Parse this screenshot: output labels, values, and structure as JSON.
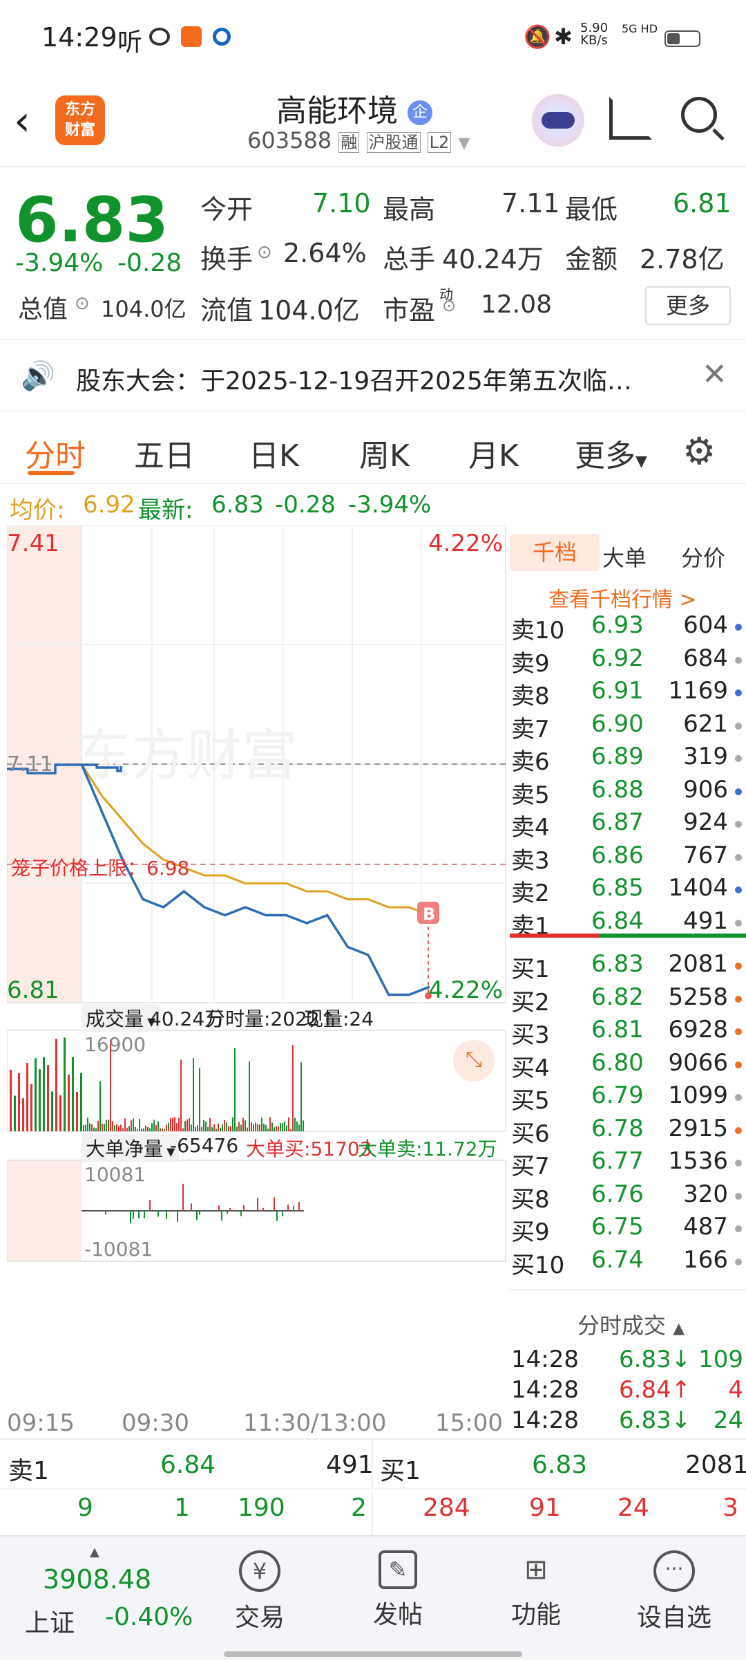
{
  "status_bar": {
    "time": "14:29",
    "listen": "听",
    "net_speed": "5.90",
    "net_unit": "KB/s",
    "net_type": "5G HD"
  },
  "nav": {
    "title": "高能环境",
    "title_badge": "企",
    "code": "603588",
    "tags": [
      "融",
      "沪股通",
      "L2"
    ],
    "logo_lines": [
      "东方",
      "财富"
    ]
  },
  "quote": {
    "price": "6.83",
    "change_pct": "-3.94%",
    "change": "-0.28",
    "open_label": "今开",
    "open": "7.10",
    "high_label": "最高",
    "high": "7.11",
    "low_label": "最低",
    "low": "6.81",
    "turnover_label": "换手",
    "turnover": "2.64%",
    "volume_label": "总手",
    "volume": "40.24万",
    "amount_label": "金额",
    "amount": "2.78亿",
    "total_mv_label": "总值",
    "total_mv": "104.0亿",
    "float_mv_label": "流值",
    "float_mv": "104.0亿",
    "pe_label": "市盈",
    "pe_sup": "动",
    "pe": "12.08",
    "more": "更多"
  },
  "notice": {
    "text": "股东大会：于2025-12-19召开2025年第五次临…"
  },
  "tabs": [
    "分时",
    "五日",
    "日K",
    "周K",
    "月K",
    "更多"
  ],
  "info_line": {
    "avg_label": "均价:",
    "avg": "6.92",
    "latest_label": "最新:",
    "latest": "6.83",
    "chg": "-0.28",
    "pct": "-3.94%"
  },
  "chart": {
    "price_top": "7.41",
    "pct_top": "4.22%",
    "price_bottom": "6.81",
    "pct_bottom": "4.22%",
    "ref_label": "7.11",
    "cage_label": "笼子价格上限：6.98",
    "watermark": "东方财富",
    "b_marker": "B",
    "vol_selector": "成交量",
    "vol_total": "40.24万",
    "vol_time": "分时量:2022↑",
    "vol_now": "现量:24",
    "vol_max": "16900",
    "flow_selector": "大单净量",
    "flow_net": "-65476",
    "flow_buy": "大单买:51703",
    "flow_sell": "大单卖:11.72万",
    "flow_max": "10081",
    "flow_min": "-10081",
    "time_labels": [
      "09:15",
      "09:30",
      "11:30/13:00",
      "15:00"
    ]
  },
  "chart_data": {
    "type": "line",
    "x": [
      "09:30",
      "09:40",
      "09:50",
      "10:00",
      "10:10",
      "10:20",
      "10:30",
      "10:45",
      "11:00",
      "11:15",
      "11:30",
      "13:15",
      "13:30",
      "13:45",
      "14:00",
      "14:10",
      "14:20",
      "14:28"
    ],
    "series": [
      {
        "values": [
          7.11,
          7.05,
          6.99,
          6.94,
          6.93,
          6.95,
          6.93,
          6.92,
          6.93,
          6.92,
          6.92,
          6.91,
          6.92,
          6.88,
          6.87,
          6.82,
          6.82,
          6.83
        ]
      },
      {
        "values": [
          7.11,
          7.07,
          7.04,
          7.01,
          6.99,
          6.98,
          6.97,
          6.97,
          6.96,
          6.96,
          6.96,
          6.95,
          6.95,
          6.94,
          6.94,
          6.93,
          6.93,
          6.92
        ]
      }
    ],
    "ylim": [
      6.81,
      7.41
    ]
  },
  "orderbook": {
    "tabs": [
      "千档",
      "大单",
      "分价"
    ],
    "link": "查看千档行情 >",
    "asks": [
      {
        "label": "卖10",
        "price": "6.93",
        "vol": "604",
        "dot": "blue"
      },
      {
        "label": "卖9",
        "price": "6.92",
        "vol": "684",
        "dot": "gray"
      },
      {
        "label": "卖8",
        "price": "6.91",
        "vol": "1169",
        "dot": "blue"
      },
      {
        "label": "卖7",
        "price": "6.90",
        "vol": "621",
        "dot": "gray"
      },
      {
        "label": "卖6",
        "price": "6.89",
        "vol": "319",
        "dot": "gray"
      },
      {
        "label": "卖5",
        "price": "6.88",
        "vol": "906",
        "dot": "blue"
      },
      {
        "label": "卖4",
        "price": "6.87",
        "vol": "924",
        "dot": "gray"
      },
      {
        "label": "卖3",
        "price": "6.86",
        "vol": "767",
        "dot": "gray"
      },
      {
        "label": "卖2",
        "price": "6.85",
        "vol": "1404",
        "dot": "blue"
      },
      {
        "label": "卖1",
        "price": "6.84",
        "vol": "491",
        "dot": "gray"
      }
    ],
    "bids": [
      {
        "label": "买1",
        "price": "6.83",
        "vol": "2081",
        "dot": "orange"
      },
      {
        "label": "买2",
        "price": "6.82",
        "vol": "5258",
        "dot": "orange"
      },
      {
        "label": "买3",
        "price": "6.81",
        "vol": "6928",
        "dot": "orange"
      },
      {
        "label": "买4",
        "price": "6.80",
        "vol": "9066",
        "dot": "orange"
      },
      {
        "label": "买5",
        "price": "6.79",
        "vol": "1099",
        "dot": "gray"
      },
      {
        "label": "买6",
        "price": "6.78",
        "vol": "2915",
        "dot": "orange"
      },
      {
        "label": "买7",
        "price": "6.77",
        "vol": "1536",
        "dot": "gray"
      },
      {
        "label": "买8",
        "price": "6.76",
        "vol": "320",
        "dot": "gray"
      },
      {
        "label": "买9",
        "price": "6.75",
        "vol": "487",
        "dot": "gray"
      },
      {
        "label": "买10",
        "price": "6.74",
        "vol": "166",
        "dot": "gray"
      }
    ],
    "trades_title": "分时成交",
    "trades": [
      {
        "time": "14:28",
        "price": "6.83↓",
        "vol": "109",
        "color": "green"
      },
      {
        "time": "14:28",
        "price": "6.84↑",
        "vol": "4",
        "color": "red"
      },
      {
        "time": "14:28",
        "price": "6.83↓",
        "vol": "24",
        "color": "green"
      }
    ]
  },
  "bottom_quote": {
    "sell_label": "卖1",
    "sell_price": "6.84",
    "sell_vol": "491",
    "buy_label": "买1",
    "buy_price": "6.83",
    "buy_vol": "2081",
    "sell_queue": [
      "9",
      "1",
      "190",
      "2"
    ],
    "buy_queue": [
      "284",
      "91",
      "24",
      "3"
    ]
  },
  "bottom_bar": {
    "index_value": "3908.48",
    "index_name": "上证",
    "index_pct": "-0.40%",
    "buttons": [
      "交易",
      "发帖",
      "功能",
      "设自选"
    ]
  }
}
